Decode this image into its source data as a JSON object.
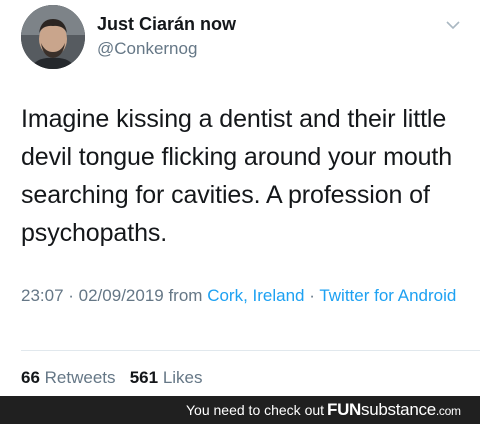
{
  "tweet": {
    "name": "Just Ciarán now",
    "handle": "@Conkernog",
    "text": "Imagine kissing a dentist and their little devil tongue flicking around your mouth searching for cavities. A profession of psychopaths.",
    "time": "23:07 · 02/09/2019 from ",
    "location": "Cork, Ireland",
    "separator": " · ",
    "source": "Twitter for Android",
    "retweets_count": "66",
    "retweets_label": "Retweets",
    "likes_count": "561",
    "likes_label": "Likes"
  },
  "footer": {
    "tagline": "You need to check out",
    "brand_fun": "FUN",
    "brand_sub": "substance",
    "brand_tld": ".com"
  },
  "icons": {
    "menu": "chevron-down-icon",
    "avatar": "avatar"
  }
}
